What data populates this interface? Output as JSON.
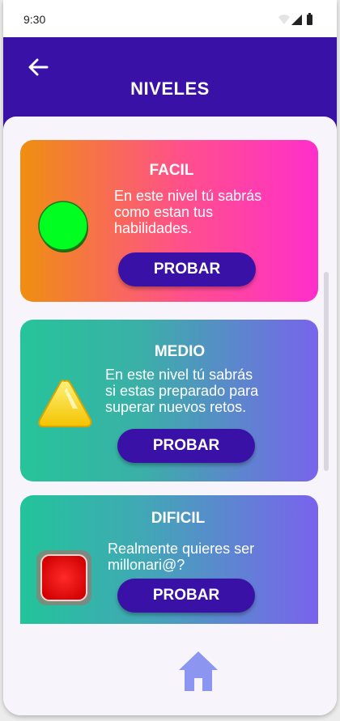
{
  "status_bar": {
    "time": "9:30",
    "icons": [
      "wifi-icon",
      "signal-icon",
      "battery-icon"
    ]
  },
  "app_bar": {
    "title": "NIVELES",
    "back_icon": "arrow-left-icon",
    "color": "#3a11a6"
  },
  "levels": [
    {
      "title": "FACIL",
      "description_lines": [
        "En este nivel tú sabrás",
        "como estan tus",
        "habilidades."
      ],
      "button_label": "PROBAR",
      "icon": "green-circle-icon"
    },
    {
      "title": "MEDIO",
      "description_lines": [
        "En este nivel tú sabrás",
        "si estas preparado para",
        "superar nuevos retos."
      ],
      "button_label": "PROBAR",
      "icon": "yellow-triangle-icon"
    },
    {
      "title": "DIFICIL",
      "description_lines": [
        "Realmente quieres ser",
        "millonari@?"
      ],
      "button_label": "PROBAR",
      "icon": "red-square-icon"
    }
  ],
  "bottom_nav": {
    "home_icon": "home-icon",
    "home_color": "#8c96f0"
  }
}
